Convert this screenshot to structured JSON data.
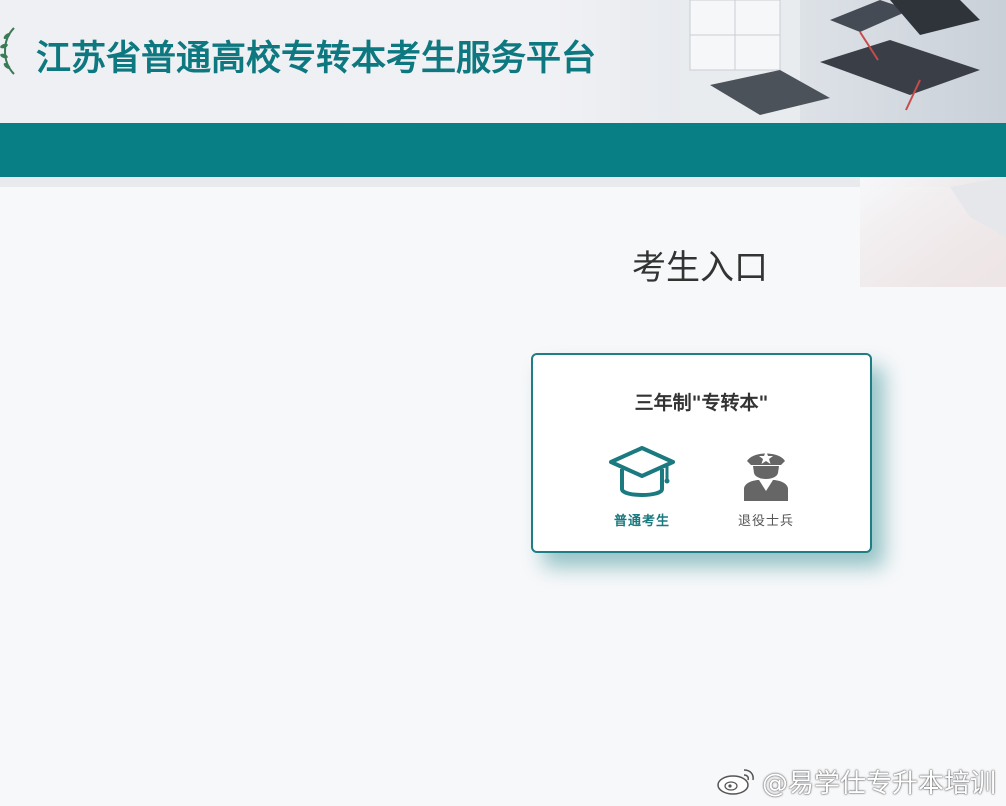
{
  "header": {
    "site_title": "江苏省普通高校专转本考生服务平台"
  },
  "main": {
    "portal_title": "考生入口"
  },
  "card": {
    "title": "三年制\"专转本\"",
    "options": [
      {
        "label": "普通考生",
        "icon": "graduation-cap-icon",
        "color": "#1a7a80"
      },
      {
        "label": "退役士兵",
        "icon": "soldier-icon",
        "color": "#666666"
      }
    ]
  },
  "watermark": {
    "text": "@易学仕专升本培训",
    "icon": "weibo-icon"
  },
  "colors": {
    "primary": "#077f85",
    "title_text": "#0e7880",
    "card_border": "#1f7e85"
  }
}
